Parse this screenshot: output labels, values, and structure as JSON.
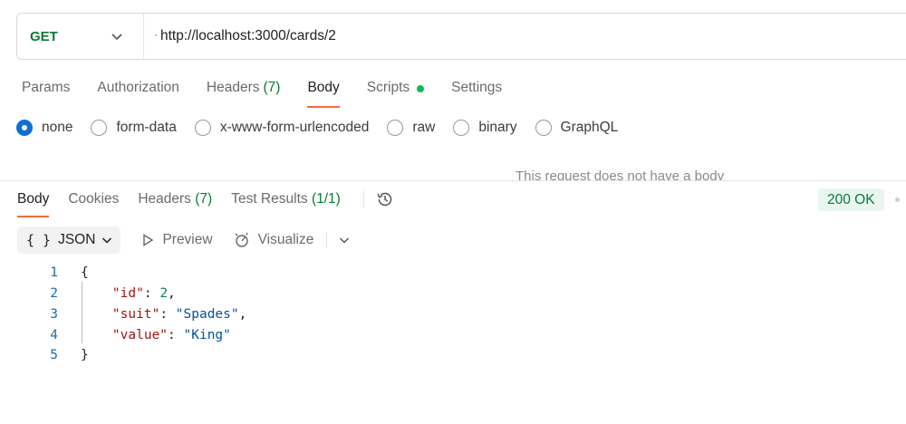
{
  "request": {
    "method": "GET",
    "url": "http://localhost:3000/cards/2"
  },
  "request_tabs": [
    {
      "label": "Params",
      "count": ""
    },
    {
      "label": "Authorization",
      "count": ""
    },
    {
      "label": "Headers",
      "count": "(7)"
    },
    {
      "label": "Body",
      "count": ""
    },
    {
      "label": "Scripts",
      "count": ""
    },
    {
      "label": "Settings",
      "count": ""
    }
  ],
  "active_request_tab": "Body",
  "body_types": [
    "none",
    "form-data",
    "x-www-form-urlencoded",
    "raw",
    "binary",
    "GraphQL"
  ],
  "selected_body_type": "none",
  "no_body_message": "This request does not have a body",
  "response_tabs": [
    {
      "label": "Body",
      "count": ""
    },
    {
      "label": "Cookies",
      "count": ""
    },
    {
      "label": "Headers",
      "count": "(7)"
    },
    {
      "label": "Test Results",
      "count": "(1/1)"
    }
  ],
  "active_response_tab": "Body",
  "status": "200 OK",
  "toolbar": {
    "format": "JSON",
    "preview": "Preview",
    "visualize": "Visualize"
  },
  "code": {
    "line_numbers": [
      "1",
      "2",
      "3",
      "4",
      "5"
    ],
    "open_brace": "{",
    "close_brace": "}",
    "entries": [
      {
        "key": "\"id\"",
        "value": "2",
        "kind": "num",
        "comma": ","
      },
      {
        "key": "\"suit\"",
        "value": "\"Spades\"",
        "kind": "str",
        "comma": ","
      },
      {
        "key": "\"value\"",
        "value": "\"King\"",
        "kind": "str",
        "comma": ""
      }
    ]
  },
  "colors": {
    "method_green": "#0b7a39",
    "active_tab_underline": "#f26b3a",
    "radio_blue": "#0f6fd1",
    "status_bg": "#e8f6ee",
    "scripts_dot": "#0cbb52"
  }
}
